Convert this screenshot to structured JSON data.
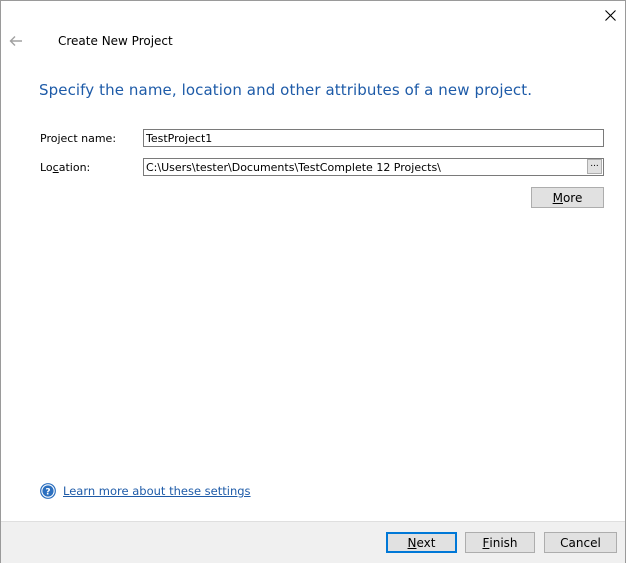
{
  "window": {
    "title": "Create New Project",
    "close_icon": "close-icon",
    "back_icon": "back-arrow-icon"
  },
  "heading": "Specify the name, location and other attributes of a new project.",
  "form": {
    "project_name_label": "Project name:",
    "project_name_value": "TestProject1",
    "location_label_pre": "Lo",
    "location_label_u": "c",
    "location_label_post": "ation:",
    "location_value": "C:\\Users\\tester\\Documents\\TestComplete 12 Projects\\",
    "browse_label": "...",
    "more_label_u": "M",
    "more_label_rest": "ore"
  },
  "help": {
    "icon": "help-icon",
    "link_text": "Learn more about these settings"
  },
  "footer": {
    "next_u": "N",
    "next_rest": "ext",
    "finish_u": "F",
    "finish_rest": "inish",
    "cancel_label": "Cancel"
  },
  "colors": {
    "accent": "#1e5ba8",
    "default_button_border": "#0078d7",
    "button_face": "#e1e1e1",
    "footer_bg": "#f0f0f0"
  }
}
